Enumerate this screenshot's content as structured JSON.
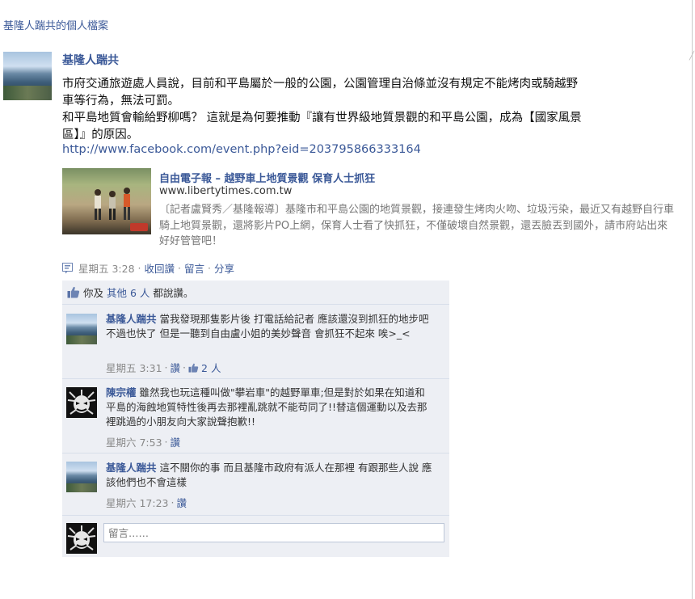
{
  "page": {
    "profile_title": "基隆人踹共的個人檔案"
  },
  "post": {
    "author": "基隆人踹共",
    "text_lines": [
      "市府交通旅遊處人員說，目前和平島屬於一般的公園，公園管理自治條並沒有規定不能烤肉或騎越野",
      "車等行為，無法可罰。",
      "和平島地質會輸給野柳嗎？ 這就是為何要推動『讓有世界級地質景觀的和平島公園，成為【國家風景",
      "區】』的原因。"
    ],
    "link_url": "http://www.facebook.com/event.php?eid=203795866333164",
    "attachment": {
      "title": "自由電子報 – 越野車上地質景觀 保育人士抓狂",
      "domain": "www.libertytimes.com.tw",
      "description": "〔記者盧賢秀／基隆報導〕基隆市和平島公園的地質景觀，接連發生烤肉火吻、垃圾污染，最近又有越野自行車騎上地質景觀，還將影片PO上網，保育人士看了快抓狂，不僅破壞自然景觀，還丟臉丟到國外，請市府站出來好好管管吧！"
    },
    "meta": {
      "time": "星期五 3:28",
      "sep": "·",
      "unlike": "收回讚",
      "comment": "留言",
      "share": "分享"
    }
  },
  "likes": {
    "prefix": "你及",
    "others_link": "其他 6 人",
    "suffix": "都說讚。"
  },
  "comments": [
    {
      "author": "基隆人踹共",
      "text": "當我發現那隻影片後 打電話給記者 應該還沒到抓狂的地步吧 不過也快了 但是一聽到自由盧小姐的美妙聲音 會抓狂不起來 唉>_<",
      "time": "星期五 3:31",
      "like_label": "讚",
      "like_count": "2 人"
    },
    {
      "author": "陳宗權",
      "text": "雖然我也玩這種叫做\"攀岩車\"的越野單車;但是對於如果在知道和平島的海蝕地質特性後再去那裡亂跳就不能苟同了!!替這個運動以及去那裡跳過的小朋友向大家說聲抱歉!!",
      "time": "星期六 7:53",
      "like_label": "讚"
    },
    {
      "author": "基隆人踹共",
      "text": "這不關你的事 而且基隆市政府有派人在那裡 有跟那些人說 應該他們也不會這樣",
      "time": "星期六 17:23",
      "like_label": "讚"
    }
  ],
  "reply": {
    "placeholder": "留言……"
  }
}
